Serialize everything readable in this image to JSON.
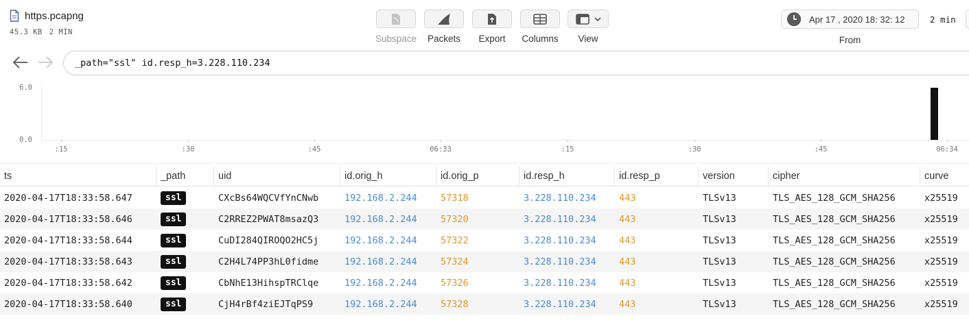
{
  "file": {
    "name": "https.pcapng",
    "size": "45.3 KB",
    "duration": "2 MIN"
  },
  "toolbar": {
    "subspace": "Subspace",
    "packets": "Packets",
    "export": "Export",
    "columns": "Columns",
    "view": "View"
  },
  "time": {
    "from_value": "Apr  17 , 2020  18: 32: 12",
    "from_label": "From",
    "duration": "2 min"
  },
  "search": {
    "query": "_path=\"ssl\" id.resp_h=3.228.110.234"
  },
  "histogram": {
    "y_ticks": [
      "6.0",
      "0.0"
    ],
    "x_ticks": [
      ":15",
      ":30",
      ":45",
      "06:33",
      ":15",
      ":30",
      ":45",
      "06:34"
    ],
    "bar_value": 6,
    "bar_color": "#111111"
  },
  "columns": [
    "ts",
    "_path",
    "uid",
    "id.orig_h",
    "id.orig_p",
    "id.resp_h",
    "id.resp_p",
    "version",
    "cipher",
    "curve"
  ],
  "rows": [
    {
      "ts": "2020-04-17T18:33:58.647",
      "path": "ssl",
      "uid": "CXcBs64WQCVfYnCNwb",
      "orig_h": "192.168.2.244",
      "orig_p": "57318",
      "resp_h": "3.228.110.234",
      "resp_p": "443",
      "version": "TLSv13",
      "cipher": "TLS_AES_128_GCM_SHA256",
      "curve": "x25519"
    },
    {
      "ts": "2020-04-17T18:33:58.646",
      "path": "ssl",
      "uid": "C2RREZ2PWAT8msazQ3",
      "orig_h": "192.168.2.244",
      "orig_p": "57320",
      "resp_h": "3.228.110.234",
      "resp_p": "443",
      "version": "TLSv13",
      "cipher": "TLS_AES_128_GCM_SHA256",
      "curve": "x25519"
    },
    {
      "ts": "2020-04-17T18:33:58.644",
      "path": "ssl",
      "uid": "CuDI284QIROQO2HC5j",
      "orig_h": "192.168.2.244",
      "orig_p": "57322",
      "resp_h": "3.228.110.234",
      "resp_p": "443",
      "version": "TLSv13",
      "cipher": "TLS_AES_128_GCM_SHA256",
      "curve": "x25519"
    },
    {
      "ts": "2020-04-17T18:33:58.643",
      "path": "ssl",
      "uid": "C2H4L74PP3hL0fidme",
      "orig_h": "192.168.2.244",
      "orig_p": "57324",
      "resp_h": "3.228.110.234",
      "resp_p": "443",
      "version": "TLSv13",
      "cipher": "TLS_AES_128_GCM_SHA256",
      "curve": "x25519"
    },
    {
      "ts": "2020-04-17T18:33:58.642",
      "path": "ssl",
      "uid": "CbNhE13HihspTRClqe",
      "orig_h": "192.168.2.244",
      "orig_p": "57326",
      "resp_h": "3.228.110.234",
      "resp_p": "443",
      "version": "TLSv13",
      "cipher": "TLS_AES_128_GCM_SHA256",
      "curve": "x25519"
    },
    {
      "ts": "2020-04-17T18:33:58.640",
      "path": "ssl",
      "uid": "CjH4rBf4ziEJTqPS9",
      "orig_h": "192.168.2.244",
      "orig_p": "57328",
      "resp_h": "3.228.110.234",
      "resp_p": "443",
      "version": "TLSv13",
      "cipher": "TLS_AES_128_GCM_SHA256",
      "curve": "x25519"
    }
  ],
  "colors": {
    "ip": "#4a8ad6",
    "port": "#e0962a",
    "badge": "#111111"
  },
  "icons": [
    "file-icon",
    "subspace-icon",
    "packets-fin-icon",
    "export-icon",
    "columns-icon",
    "view-icon",
    "chevron-down-icon",
    "clock-icon",
    "back-arrow-icon",
    "forward-arrow-icon"
  ]
}
